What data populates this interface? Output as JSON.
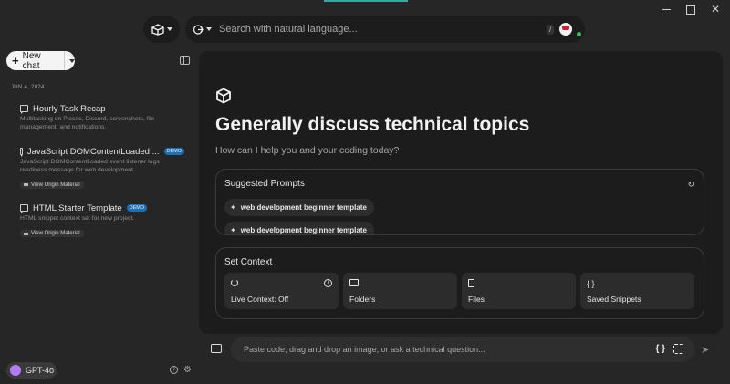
{
  "search": {
    "placeholder": "Search with natural language...",
    "shortcut": "/"
  },
  "sidebar": {
    "new_chat_label": "New chat",
    "date_group": "JUN 4, 2024",
    "chats": [
      {
        "title": "Hourly Task Recap",
        "description": "Multitasking on Pieces, Discord, screenshots, file management, and notifications.",
        "badge": "",
        "origin": ""
      },
      {
        "title": "JavaScript DOMContentLoaded ...",
        "description": "JavaScript DOMContentLoaded event listener logs readiness message for web development.",
        "badge": "DEMO",
        "origin": "View Origin Material"
      },
      {
        "title": "HTML Starter Template",
        "description": "HTML snippet context set for new project.",
        "badge": "DEMO",
        "origin": "View Origin Material"
      }
    ],
    "model_label": "GPT-4o"
  },
  "main": {
    "title": "Generally discuss technical topics",
    "subtitle": "How can I help you and your coding today?",
    "suggested": {
      "title": "Suggested Prompts",
      "prompts": [
        "web development beginner template",
        "web development beginner template"
      ]
    },
    "context": {
      "title": "Set Context",
      "tiles": [
        {
          "label": "Live Context: Off",
          "icon": "live-context-icon"
        },
        {
          "label": "Folders",
          "icon": "folder-icon"
        },
        {
          "label": "Files",
          "icon": "file-icon"
        },
        {
          "label": "Saved Snippets",
          "icon": "code-braces-icon"
        }
      ]
    }
  },
  "chat_input": {
    "placeholder": "Paste code, drag and drop an image, or ask a technical question..."
  },
  "colors": {
    "background": "#262626",
    "panel": "#1c1c1c",
    "accent_line": "#3aa6a6",
    "demo_badge": "#1f6fb3",
    "model_icon": "#b57bff",
    "status_online": "#2ec75a"
  }
}
